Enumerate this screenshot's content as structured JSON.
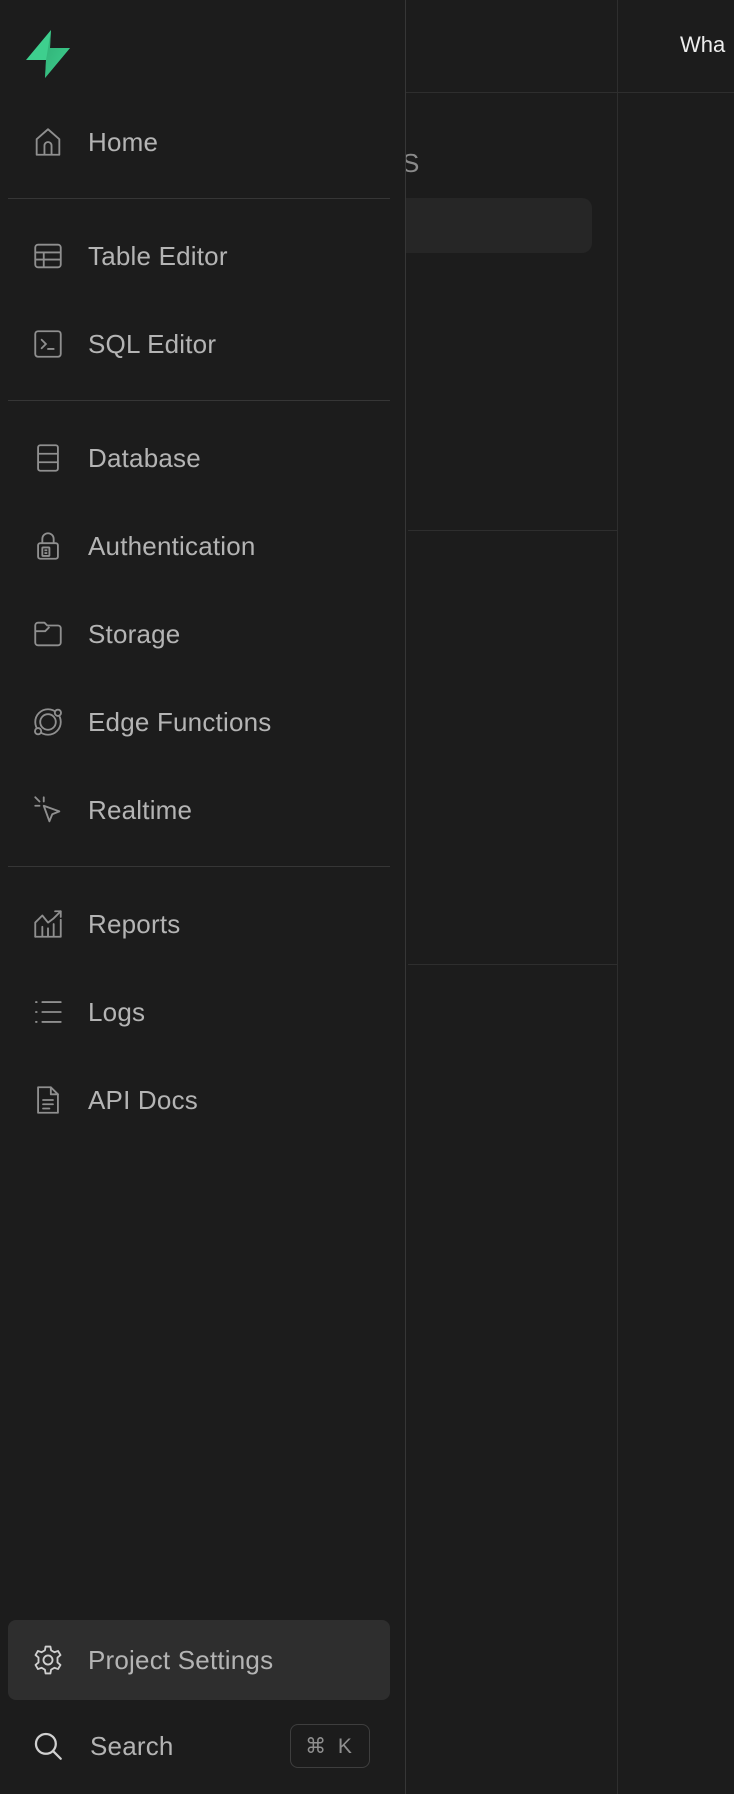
{
  "background": {
    "topbar_text": "Wha",
    "panel_text": "S"
  },
  "colors": {
    "brand_green": "#3ecf8e",
    "sidebar_bg": "#1c1c1c",
    "active_item_bg": "#2e2e2e",
    "text": "#b4b4b4"
  },
  "sidebar": {
    "logo_icon": "supabase-logo",
    "items": [
      {
        "label": "Home",
        "icon": "home-icon"
      },
      {
        "label": "Table Editor",
        "icon": "table-icon"
      },
      {
        "label": "SQL Editor",
        "icon": "terminal-icon"
      },
      {
        "label": "Database",
        "icon": "database-icon"
      },
      {
        "label": "Authentication",
        "icon": "lock-icon"
      },
      {
        "label": "Storage",
        "icon": "folder-icon"
      },
      {
        "label": "Edge Functions",
        "icon": "orbit-icon"
      },
      {
        "label": "Realtime",
        "icon": "pointer-icon"
      },
      {
        "label": "Reports",
        "icon": "chart-icon"
      },
      {
        "label": "Logs",
        "icon": "list-icon"
      },
      {
        "label": "API Docs",
        "icon": "document-icon"
      }
    ],
    "settings": {
      "label": "Project Settings",
      "icon": "gear-icon",
      "active": true
    },
    "search": {
      "label": "Search",
      "icon": "search-icon",
      "shortcut": "⌘ K"
    }
  }
}
